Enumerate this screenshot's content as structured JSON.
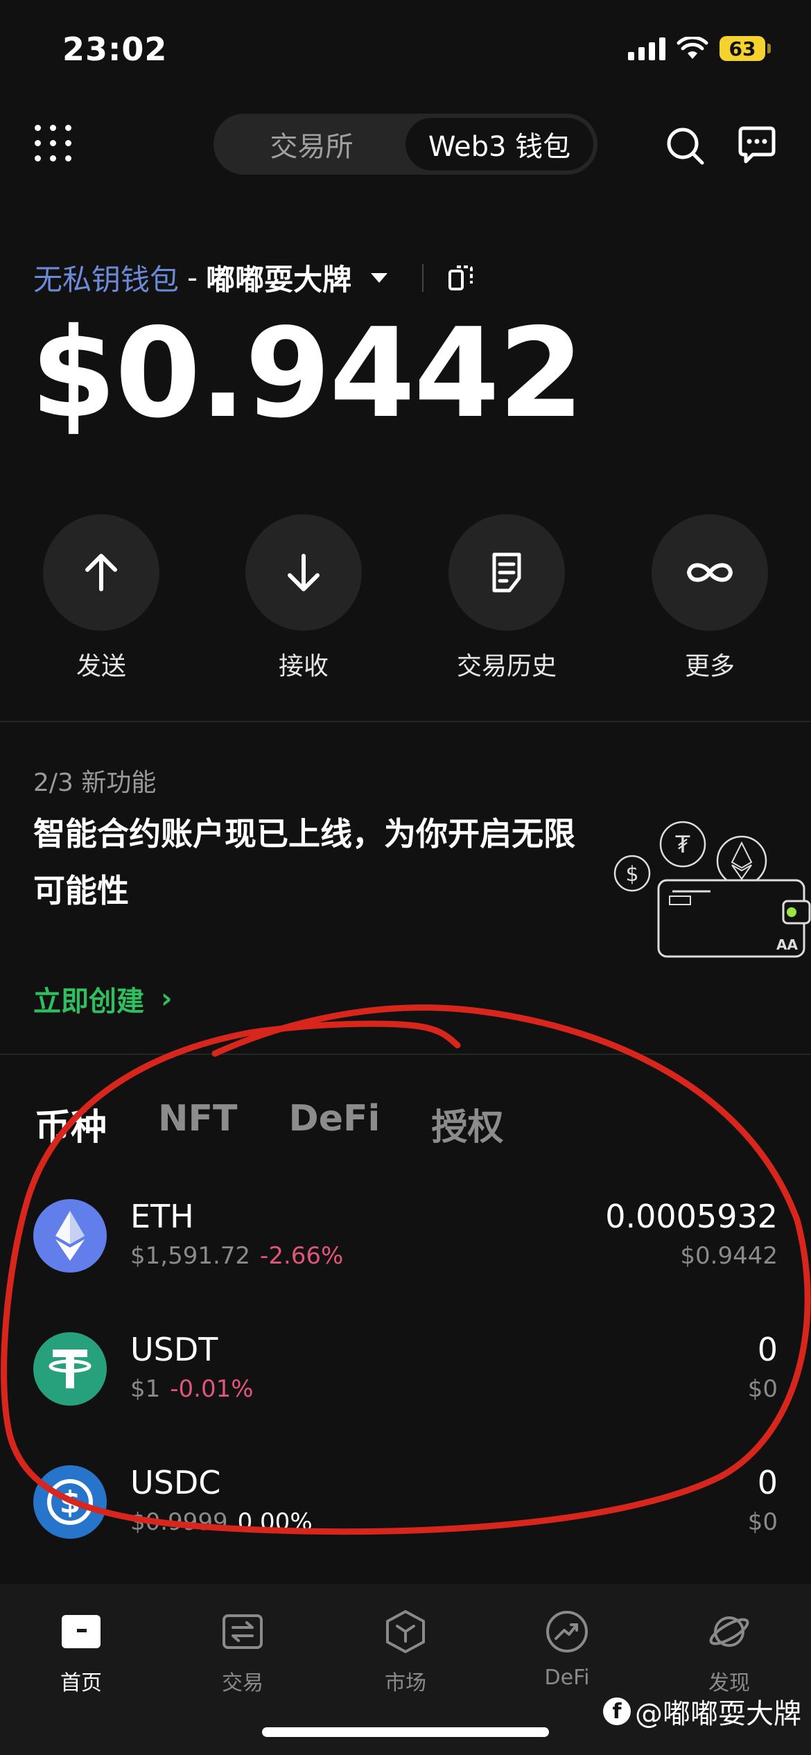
{
  "status_bar": {
    "time": "23:02",
    "battery": "63"
  },
  "header": {
    "tabs": [
      {
        "label": "交易所",
        "active": false
      },
      {
        "label": "Web3 钱包",
        "active": true
      }
    ]
  },
  "wallet": {
    "type": "无私钥钱包",
    "separator": "-",
    "name": "嘟嘟耍大牌",
    "balance": "$0.9442"
  },
  "actions": [
    {
      "label": "发送",
      "icon": "arrow-up-icon"
    },
    {
      "label": "接收",
      "icon": "arrow-down-icon"
    },
    {
      "label": "交易历史",
      "icon": "history-icon"
    },
    {
      "label": "更多",
      "icon": "more-infinity-icon"
    }
  ],
  "promo": {
    "counter": "2/3 新功能",
    "title": "智能合约账户现已上线，为你开启无限可能性",
    "link": "立即创建",
    "link_arrow": "›",
    "art_label": "AA"
  },
  "asset_tabs": [
    {
      "label": "币种",
      "active": true
    },
    {
      "label": "NFT",
      "active": false
    },
    {
      "label": "DeFi",
      "active": false
    },
    {
      "label": "授权",
      "active": false
    }
  ],
  "assets": [
    {
      "symbol": "ETH",
      "price": "$1,591.72",
      "change": "-2.66%",
      "amount": "0.0005932",
      "value": "$0.9442",
      "color": "#627eea"
    },
    {
      "symbol": "USDT",
      "price": "$1",
      "change": "-0.01%",
      "amount": "0",
      "value": "$0",
      "color": "#26a17b"
    },
    {
      "symbol": "USDC",
      "price": "$0.9999",
      "change": "0.00%",
      "amount": "0",
      "value": "$0",
      "color": "#2775ca"
    }
  ],
  "bottom_nav": [
    {
      "label": "首页",
      "active": true
    },
    {
      "label": "交易",
      "active": false
    },
    {
      "label": "市场",
      "active": false
    },
    {
      "label": "DeFi",
      "active": false
    },
    {
      "label": "发现",
      "active": false
    }
  ],
  "watermark": "@嘟嘟耍大牌",
  "colors": {
    "accent_green": "#2fbf5e",
    "negative": "#e0557a",
    "wallet_blue": "#6b8bd8",
    "annotation_red": "#d8261c"
  }
}
